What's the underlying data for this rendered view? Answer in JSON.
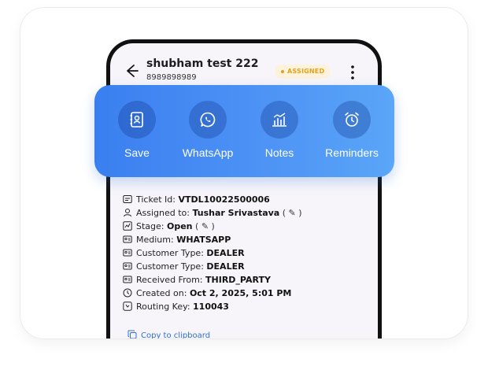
{
  "contact": {
    "name": "shubham test 222",
    "phone": "8989898989",
    "status": "ASSIGNED"
  },
  "actions": [
    {
      "label": "Save",
      "icon": "contact-book-icon"
    },
    {
      "label": "WhatsApp",
      "icon": "whatsapp-icon"
    },
    {
      "label": "Notes",
      "icon": "notes-icon"
    },
    {
      "label": "Reminders",
      "icon": "alarm-clock-icon"
    }
  ],
  "details": [
    {
      "label": "Ticket Id:",
      "value": "VTDL10022500006",
      "icon": "ticket-icon"
    },
    {
      "label": "Assigned to:",
      "value": "Tushar Srivastava",
      "suffix": "( ✎ )",
      "icon": "person-icon"
    },
    {
      "label": "Stage:",
      "value": "Open",
      "suffix": "( ✎ )",
      "icon": "stage-icon"
    },
    {
      "label": "Medium:",
      "value": "WHATSAPP",
      "icon": "id-card-icon"
    },
    {
      "label": "Customer Type:",
      "value": "DEALER",
      "icon": "id-card-icon"
    },
    {
      "label": "Customer Type:",
      "value": "DEALER",
      "icon": "id-card-icon"
    },
    {
      "label": "Received From:",
      "value": "THIRD_PARTY",
      "icon": "id-card-icon"
    },
    {
      "label": "Created on:",
      "value": "Oct 2, 2025, 5:01 PM",
      "icon": "clock-icon"
    },
    {
      "label": "Routing Key:",
      "value": "110043",
      "icon": "key-icon"
    }
  ],
  "copy_label": "Copy to clipboard",
  "colors": {
    "accent": "#3a7ff0",
    "badge_text": "#e3a21a",
    "badge_bg": "#fdf3dc"
  }
}
